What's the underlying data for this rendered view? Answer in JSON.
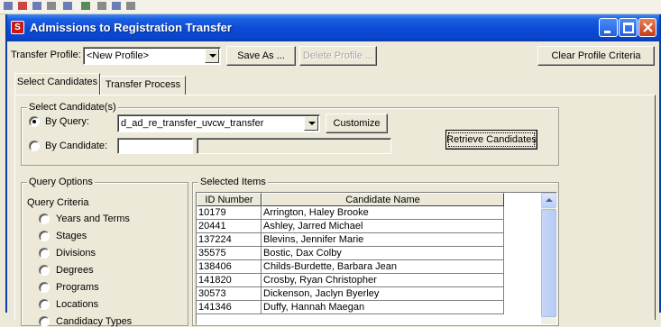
{
  "window": {
    "title": "Admissions to Registration Transfer"
  },
  "profile": {
    "label": "Transfer Profile:",
    "selected": "<New Profile>",
    "save_as_label": "Save As ...",
    "delete_label": "Delete Profile ...",
    "clear_label": "Clear Profile Criteria"
  },
  "tabs": [
    {
      "label": "Select Candidates"
    },
    {
      "label": "Transfer Process"
    }
  ],
  "select_candidates": {
    "group_title": "Select Candidate(s)",
    "by_query_label": "By Query:",
    "query_value": "d_ad_re_transfer_uvcw_transfer",
    "customize_label": "Customize",
    "by_candidate_label": "By Candidate:",
    "retrieve_label": "Retrieve Candidates"
  },
  "query_options": {
    "group_title": "Query Options",
    "criteria_label": "Query Criteria",
    "items": [
      {
        "label": "Years and Terms"
      },
      {
        "label": "Stages"
      },
      {
        "label": "Divisions"
      },
      {
        "label": "Degrees"
      },
      {
        "label": "Programs"
      },
      {
        "label": "Locations"
      },
      {
        "label": "Candidacy Types"
      }
    ]
  },
  "selected_items": {
    "group_title": "Selected Items",
    "columns": [
      "ID Number",
      "Candidate Name"
    ],
    "rows": [
      {
        "id": "10179",
        "name": "Arrington, Haley Brooke"
      },
      {
        "id": "20441",
        "name": "Ashley, Jarred Michael"
      },
      {
        "id": "137224",
        "name": "Blevins, Jennifer Marie"
      },
      {
        "id": "35575",
        "name": "Bostic, Dax Colby"
      },
      {
        "id": "138406",
        "name": "Childs-Burdette, Barbara Jean"
      },
      {
        "id": "141820",
        "name": "Crosby, Ryan Christopher"
      },
      {
        "id": "30573",
        "name": "Dickenson, Jaclyn Byerley"
      },
      {
        "id": "141346",
        "name": "Duffy, Hannah Maegan"
      }
    ]
  },
  "colors": {
    "titlebar": "#0b49d6",
    "window_bg": "#ece9d8",
    "close_button": "#c73a16"
  }
}
